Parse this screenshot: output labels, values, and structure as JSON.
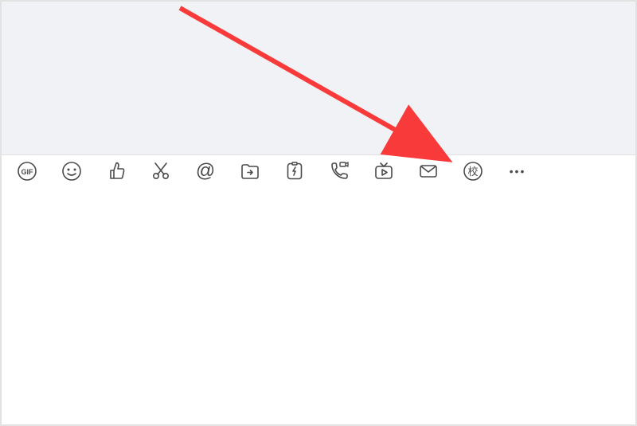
{
  "toolbar": {
    "gif_label": "GIF",
    "at_symbol": "@",
    "school_character": "校",
    "more_dots": "•••"
  },
  "icons": {
    "gif": "gif-icon",
    "emoji": "emoji-icon",
    "thumbs_up": "thumbs-up-icon",
    "screenshot": "scissors-icon",
    "mention": "at-icon",
    "file": "folder-arrow-icon",
    "flash": "flash-card-icon",
    "call": "phone-video-icon",
    "together": "tv-play-icon",
    "envelope": "envelope-icon",
    "school": "school-icon",
    "more": "more-icon"
  },
  "annotation": {
    "arrow_color": "#f93a3a"
  }
}
